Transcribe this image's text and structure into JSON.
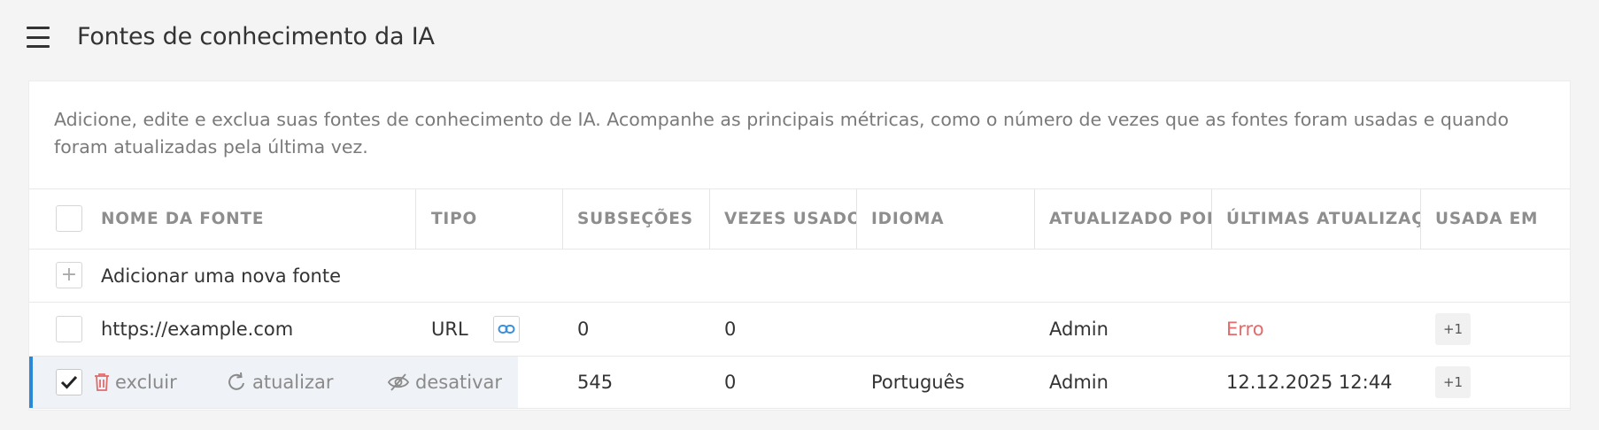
{
  "header": {
    "menu_icon": "hamburger-menu-icon",
    "title": "Fontes de conhecimento da IA"
  },
  "description": "Adicione, edite e exclua suas fontes de conhecimento de IA. Acompanhe as principais métricas, como o número de vezes que as fontes foram usadas e quando foram atualizadas pela última vez.",
  "table": {
    "columns": [
      "NOME DA FONTE",
      "TIPO",
      "SUBSEÇÕES",
      "VEZES USADO",
      "IDIOMA",
      "ATUALIZADO POR",
      "ÚLTIMAS ATUALIZAÇÕES",
      "USADA EM"
    ],
    "add_label": "Adicionar uma nova fonte",
    "rows": [
      {
        "name": "https://example.com",
        "type": "URL",
        "type_icon": "link-icon",
        "subsections": "0",
        "times_used": "0",
        "language": "",
        "updated_by": "Admin",
        "last_update": "Erro",
        "used_in": "+1",
        "selected": false
      },
      {
        "name": "",
        "type": "",
        "subsections": "545",
        "times_used": "0",
        "language": "Português",
        "updated_by": "Admin",
        "last_update": "12.12.2025 12:44",
        "used_in": "+1",
        "selected": true
      }
    ],
    "row_actions": {
      "delete": "excluir",
      "refresh": "atualizar",
      "disable": "desativar"
    }
  },
  "colors": {
    "accent": "#2b88d8",
    "error": "#e06c6c",
    "delete_icon": "#e06c6c"
  }
}
